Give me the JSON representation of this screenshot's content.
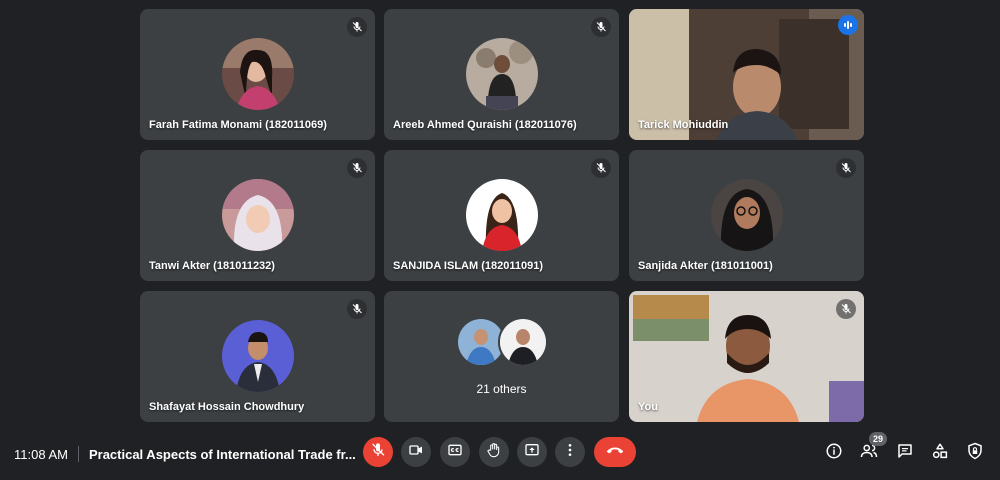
{
  "participants": [
    {
      "name": "Farah Fatima Monami (182011069)"
    },
    {
      "name": "Areeb Ahmed Quraishi (182011076)"
    },
    {
      "name": "Tarick Mohiuddin"
    },
    {
      "name": "Tanwi Akter (181011232)"
    },
    {
      "name": "SANJIDA ISLAM (182011091)"
    },
    {
      "name": "Sanjida Akter (181011001)"
    },
    {
      "name": "Shafayat Hossain Chowdhury"
    },
    {
      "name": "You"
    }
  ],
  "others_label": "21 others",
  "bottom_bar": {
    "time": "11:08 AM",
    "meeting_title": "Practical Aspects of International Trade fr...",
    "people_count": "29"
  },
  "colors": {
    "background": "#202124",
    "tile": "#3c4043",
    "end_call": "#ea4335",
    "active_speaker": "#8ab4f8"
  }
}
